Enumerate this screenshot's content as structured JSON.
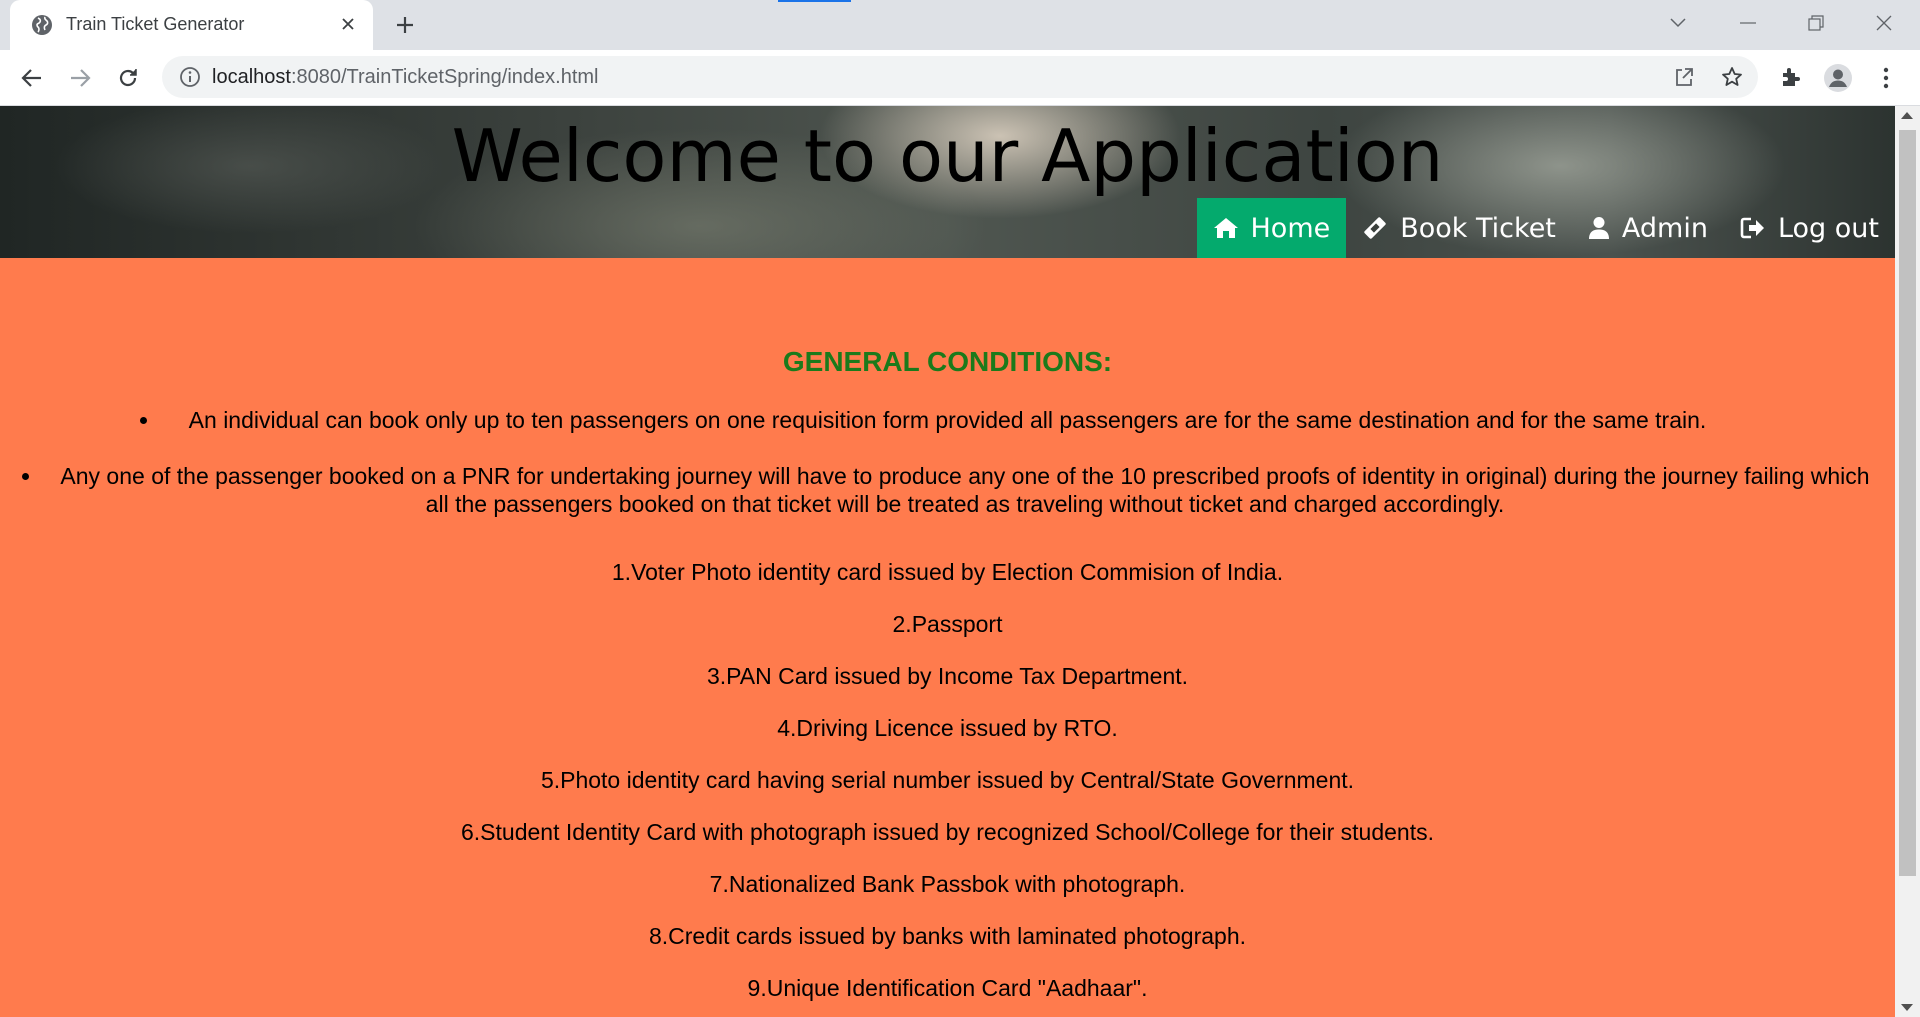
{
  "browser": {
    "tab_title": "Train Ticket Generator",
    "url_host": "localhost",
    "url_rest": ":8080/TrainTicketSpring/index.html"
  },
  "page": {
    "banner_title": "Welcome to our Application",
    "nav": {
      "home": "Home",
      "book_ticket": "Book Ticket",
      "admin": "Admin",
      "logout": "Log out"
    },
    "heading": "GENERAL CONDITIONS:",
    "bullets": [
      "An individual can book only up to ten passengers on one requisition form provided all passengers are for the same destination and for the same train.",
      "Any one of the passenger booked on a PNR for undertaking journey will have to produce any one of the 10 prescribed proofs of identity in original) during the journey failing which all the passengers booked on that ticket will be treated as traveling without ticket and charged accordingly."
    ],
    "proofs": [
      "1.Voter Photo identity card issued by Election Commision of India.",
      "2.Passport",
      "3.PAN Card issued by Income Tax Department.",
      "4.Driving Licence issued by RTO.",
      "5.Photo identity card having serial number issued by Central/State Government.",
      "6.Student Identity Card with photograph issued by recognized School/College for their students.",
      "7.Nationalized Bank Passbok with photograph.",
      "8.Credit cards issued by banks with laminated photograph.",
      "9.Unique Identification Card \"Aadhaar\"."
    ]
  },
  "colors": {
    "page_background": "#ff7b4d",
    "nav_active": "#04aa6d",
    "heading": "#1b7a1b"
  },
  "icons": {
    "tab": "globe-icon",
    "nav_home": "home-icon",
    "nav_book": "ticket-icon",
    "nav_admin": "user-icon",
    "nav_logout": "sign-out-icon"
  }
}
